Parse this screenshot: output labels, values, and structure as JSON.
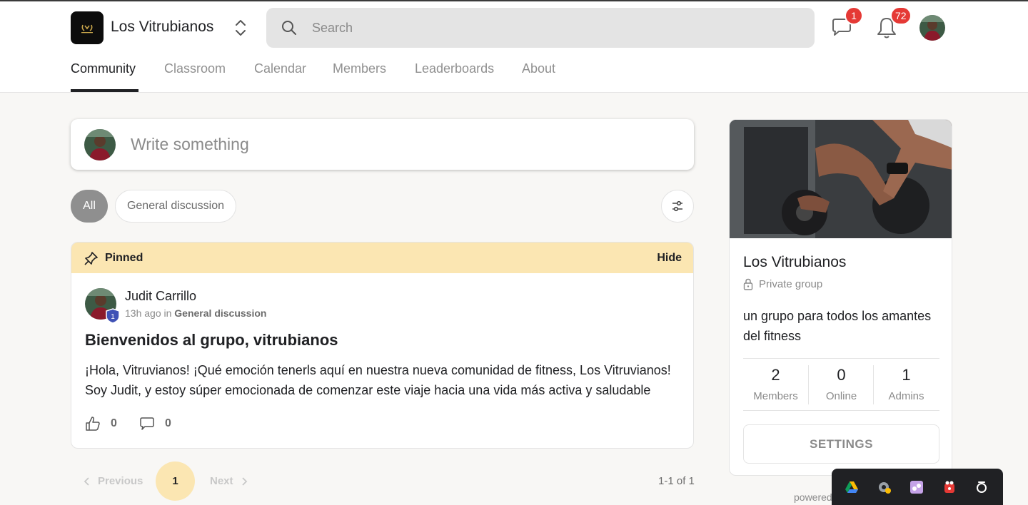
{
  "header": {
    "group_name": "Los Vitrubianos",
    "search_placeholder": "Search",
    "chat_badge": "1",
    "notif_badge": "72"
  },
  "tabs": [
    {
      "label": "Community",
      "active": true
    },
    {
      "label": "Classroom"
    },
    {
      "label": "Calendar"
    },
    {
      "label": "Members"
    },
    {
      "label": "Leaderboards"
    },
    {
      "label": "About"
    }
  ],
  "composer": {
    "placeholder": "Write something"
  },
  "filters": {
    "all": "All",
    "general": "General discussion"
  },
  "post": {
    "pinned_label": "Pinned",
    "hide_label": "Hide",
    "author": "Judit Carrillo",
    "level": "1",
    "time": "13h ago",
    "in_word": "in",
    "category": "General discussion",
    "title": "Bienvenidos al grupo, vitrubianos",
    "body": "¡Hola, Vitruvianos! ¡Qué emoción tenerls aquí en nuestra nueva comunidad de fitness, Los Vitruvianos! Soy Judit, y estoy súper emocionada de comenzar este viaje hacia una vida más activa y saludable",
    "likes": "0",
    "comments": "0"
  },
  "pagination": {
    "previous": "Previous",
    "current": "1",
    "next": "Next",
    "count": "1-1 of 1"
  },
  "sidebar": {
    "name": "Los Vitrubianos",
    "privacy": "Private group",
    "description": "un grupo para todos los amantes del fitness",
    "stats": [
      {
        "value": "2",
        "label": "Members"
      },
      {
        "value": "0",
        "label": "Online"
      },
      {
        "value": "1",
        "label": "Admins"
      }
    ],
    "settings_label": "SETTINGS"
  },
  "footer": {
    "powered": "powered"
  },
  "colors": {
    "accent_yellow": "#fbe6b2",
    "badge_red": "#e53935",
    "level_blue": "#3f51b5"
  }
}
